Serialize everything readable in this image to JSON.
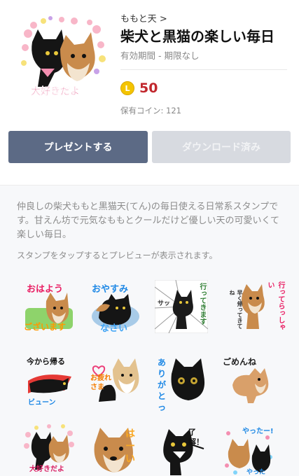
{
  "product": {
    "author": "ももと天 >",
    "title": "柴犬と黒猫の楽しい毎日",
    "period": "有効期間 - 期限なし",
    "coin_symbol": "L",
    "price": "50",
    "owned_coins": "保有コイン: 121",
    "main_image_caption": "大好きだよ"
  },
  "buttons": {
    "present": "プレゼントする",
    "download": "ダウンロード済み"
  },
  "content": {
    "description": "仲良しの柴犬ももと黒猫天(てん)の毎日使える日常系スタンプです。甘えん坊で元気なももとクールだけど優しい天の可愛いくて楽しい毎日。",
    "preview_hint": "スタンプをタップするとプレビューが表示されます。"
  },
  "stickers": [
    {
      "line1": "おはよう",
      "line2": "ございます"
    },
    {
      "line1": "おやすみ",
      "line2": "なさい"
    },
    {
      "line1": "サッ",
      "line2": "行ってきます"
    },
    {
      "line1": "早く帰ってきてね",
      "line2": "行ってらっしゃい"
    },
    {
      "line1": "今から帰る",
      "line2": "ビューン"
    },
    {
      "line1": "お疲れさま",
      "line2": ""
    },
    {
      "line1": "ありがとっ",
      "line2": ""
    },
    {
      "line1": "ごめんね",
      "line2": ""
    },
    {
      "line1": "大好きだよ",
      "line2": ""
    },
    {
      "line1": "はーい",
      "line2": ""
    },
    {
      "line1": "了解！",
      "line2": ""
    },
    {
      "line1": "やったー!",
      "line2": "やったー!"
    }
  ],
  "colors": {
    "present_button": "#5c6a85",
    "download_button": "#d7dae0",
    "price": "#c1272d",
    "coin": "#f4c400"
  }
}
